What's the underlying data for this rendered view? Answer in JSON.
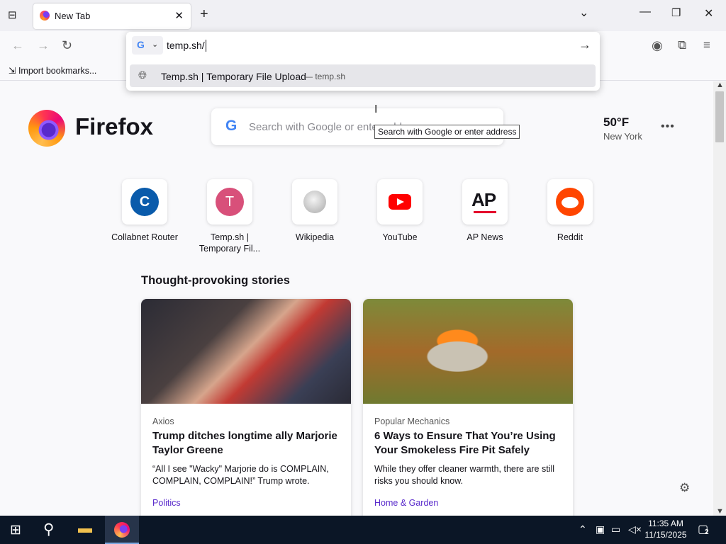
{
  "browser": {
    "tab": {
      "title": "New Tab"
    },
    "url_input": {
      "value": "temp.sh/"
    },
    "suggestion": {
      "title": "Temp.sh | Temporary File Upload",
      "separator": "—",
      "domain": "temp.sh"
    },
    "bookmarks": {
      "import_label": "Import bookmarks..."
    }
  },
  "newtab": {
    "brand": "Firefox",
    "search": {
      "placeholder": "Search with Google or enter address",
      "tooltip": "Search with Google or enter address"
    },
    "weather": {
      "temp": "50°F",
      "city": "New York"
    },
    "shortcuts": [
      {
        "label": "Collabnet Router",
        "letter": "C",
        "color": "#0a5bab"
      },
      {
        "label": "Temp.sh | Temporary Fil...",
        "letter": "T",
        "color": "#d8507a"
      },
      {
        "label": "Wikipedia"
      },
      {
        "label": "YouTube"
      },
      {
        "label": "AP News",
        "logo": "AP"
      },
      {
        "label": "Reddit"
      }
    ],
    "stories": {
      "heading": "Thought-provoking stories",
      "items": [
        {
          "source": "Axios",
          "headline": "Trump ditches longtime ally Marjorie Taylor Greene",
          "excerpt": "“All I see \"Wacky\" Marjorie do is COMPLAIN, COMPLAIN, COMPLAIN!” Trump wrote.",
          "category": "Politics"
        },
        {
          "source": "Popular Mechanics",
          "headline": "6 Ways to Ensure That You’re Using Your Smokeless Fire Pit Safely",
          "excerpt": "While they offer cleaner warmth, there are still risks you should know.",
          "category": "Home & Garden"
        }
      ]
    }
  },
  "taskbar": {
    "time": "11:35 AM",
    "date": "11/15/2025",
    "notification_count": "2"
  },
  "colors": {
    "accent": "#592acb",
    "taskbar": "#0b1626"
  }
}
